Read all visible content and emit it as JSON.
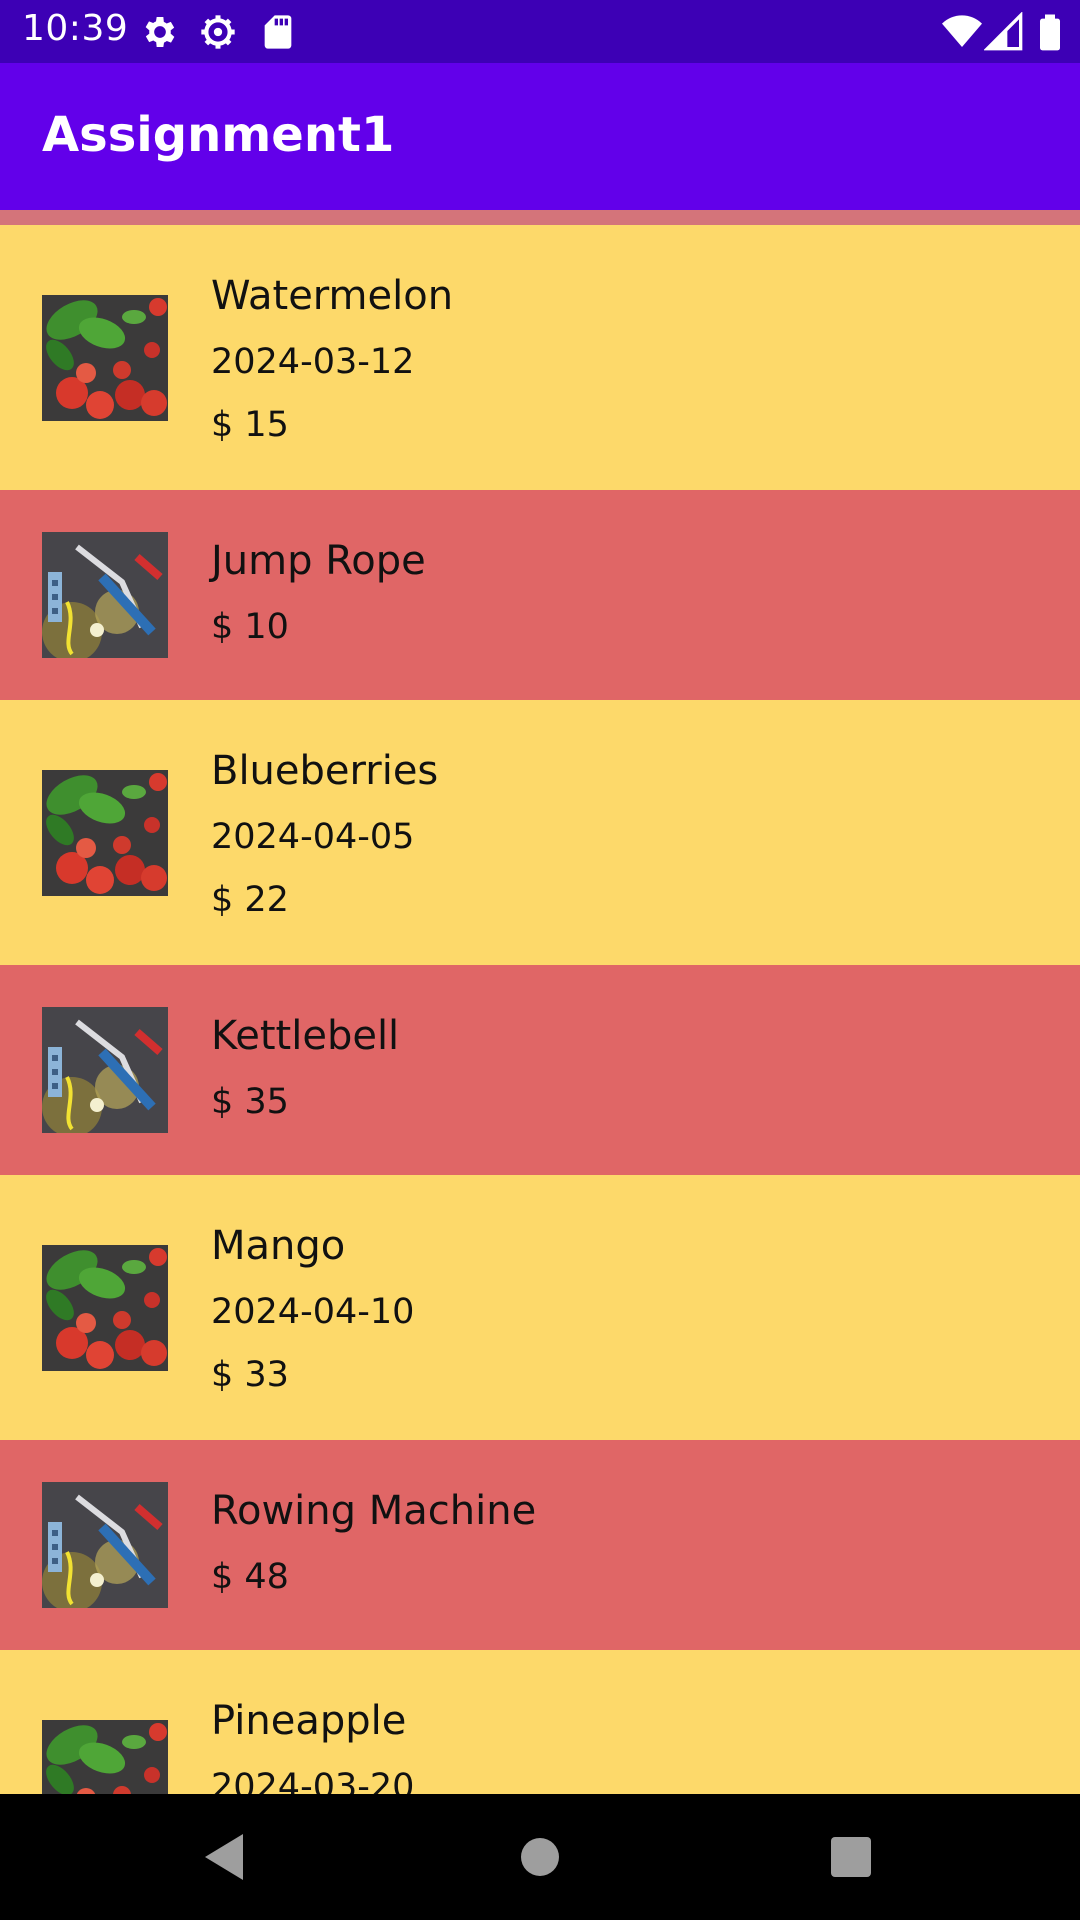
{
  "status_bar": {
    "time": "10:39",
    "icons": [
      "gear-icon",
      "gear-icon",
      "sd-card-icon",
      "wifi-icon",
      "signal-icon",
      "battery-icon"
    ]
  },
  "app_bar": {
    "title": "Assignment1"
  },
  "colors": {
    "status_bar": "#3d00b5",
    "app_bar": "#6200ea",
    "food_row": "#fdd96a",
    "sport_row": "#e06666"
  },
  "items": [
    {
      "name": "Watermelon",
      "date": "2024-03-12",
      "price": "$ 15",
      "category": "food"
    },
    {
      "name": "Jump Rope",
      "price": "$ 10",
      "category": "sport"
    },
    {
      "name": "Blueberries",
      "date": "2024-04-05",
      "price": "$ 22",
      "category": "food"
    },
    {
      "name": "Kettlebell",
      "price": "$ 35",
      "category": "sport"
    },
    {
      "name": "Mango",
      "date": "2024-04-10",
      "price": "$ 33",
      "category": "food"
    },
    {
      "name": "Rowing Machine",
      "price": "$ 48",
      "category": "sport"
    },
    {
      "name": "Pineapple",
      "date": "2024-03-20",
      "category": "food"
    }
  ],
  "nav": {
    "icons": [
      "back-icon",
      "home-icon",
      "recents-icon"
    ]
  }
}
